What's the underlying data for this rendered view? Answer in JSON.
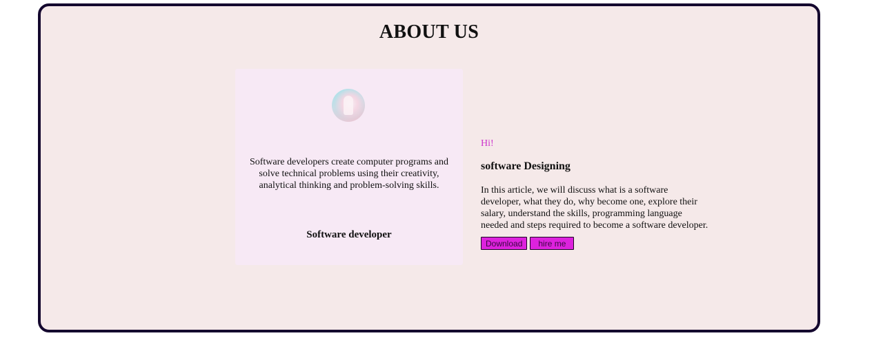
{
  "page": {
    "title": "ABOUT US"
  },
  "card": {
    "avatar": "profile-avatar",
    "description": "Software developers create computer programs and solve technical problems using their creativity, analytical thinking and problem-solving skills.",
    "role": "Software developer"
  },
  "intro": {
    "greeting": "Hi!",
    "title": "software Designing",
    "body": "In this article, we will discuss what is a software developer, what they do, why become one, explore their salary, understand the skills, programming language needed and steps required to become a software developer."
  },
  "actions": {
    "download_label": "Download",
    "hire_label": "hire me"
  },
  "colors": {
    "frame_border": "#14072e",
    "frame_background": "#f5e9e9",
    "card_background": "#f7e9f5",
    "greeting_color": "#cc33cc",
    "button_background": "#dd22dd"
  }
}
